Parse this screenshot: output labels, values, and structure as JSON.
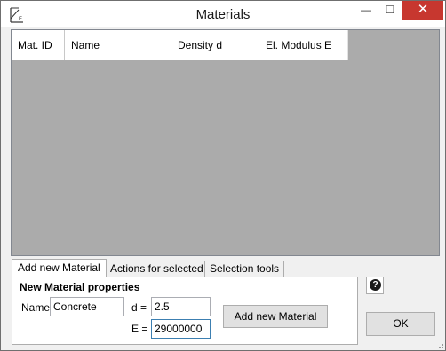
{
  "window": {
    "title": "Materials",
    "minimize_glyph": "—",
    "maximize_glyph": "☐",
    "close_glyph": "✕",
    "icon": "app-logo-icon",
    "icon_text": "Ḿ",
    "icon_subtext": "E"
  },
  "grid": {
    "columns": [
      "Mat. ID",
      "Name",
      "Density d",
      "El. Modulus E"
    ],
    "rows": []
  },
  "tabs": [
    {
      "label": "Add new Material",
      "active": true
    },
    {
      "label": "Actions for selected",
      "active": false
    },
    {
      "label": "Selection tools",
      "active": false
    }
  ],
  "form": {
    "heading": "New Material properties",
    "name_label": "Name",
    "name_value": "Concrete",
    "d_label": "d =",
    "d_value": "2.5",
    "e_label": "E =",
    "e_value": "29000000",
    "add_button": "Add new Material"
  },
  "help_icon": "help-icon",
  "help_glyph": "?",
  "ok_button": "OK",
  "colors": {
    "grid_background": "#ababab",
    "close_button": "#c7372f",
    "focused_border": "#3c7fb1"
  }
}
